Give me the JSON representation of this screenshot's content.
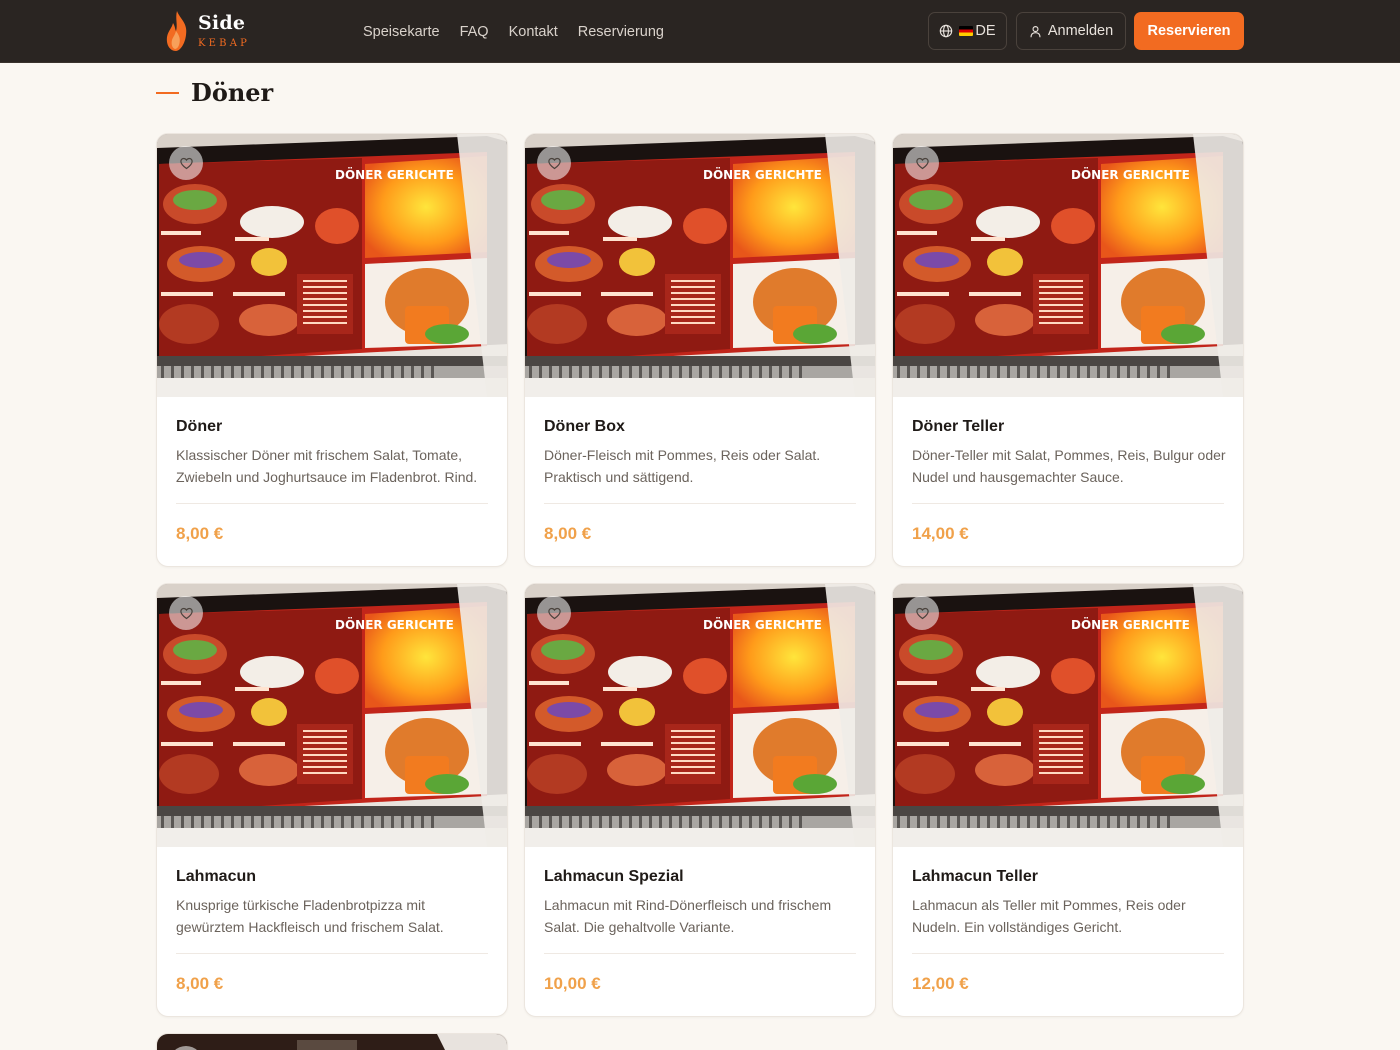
{
  "brand": {
    "name": "Side",
    "tagline": "KEBAP",
    "accent": "#f26b21"
  },
  "nav": [
    {
      "label": "Speisekarte"
    },
    {
      "label": "FAQ"
    },
    {
      "label": "Kontakt"
    },
    {
      "label": "Reservierung"
    }
  ],
  "header": {
    "lang_label": "DE",
    "login_label": "Anmelden",
    "reserve_label": "Reservieren"
  },
  "section": {
    "title": "Döner"
  },
  "image_signage": {
    "heading": "DÖNER GERICHTE"
  },
  "items": [
    {
      "name": "Döner",
      "description": "Klassischer Döner mit frischem Salat, Tomate, Zwiebeln und Joghurtsauce im Fladenbrot. Rind.",
      "price": "8,00 €"
    },
    {
      "name": "Döner Box",
      "description": "Döner-Fleisch mit Pommes, Reis oder Salat. Praktisch und sättigend.",
      "price": "8,00 €"
    },
    {
      "name": "Döner Teller",
      "description": "Döner-Teller mit Salat, Pommes, Reis, Bulgur oder Nudel und hausgemachter Sauce.",
      "price": "14,00 €"
    },
    {
      "name": "Lahmacun",
      "description": "Knusprige türkische Fladenbrotpizza mit gewürztem Hackfleisch und frischem Salat.",
      "price": "8,00 €"
    },
    {
      "name": "Lahmacun Spezial",
      "description": "Lahmacun mit Rind-Dönerfleisch und frischem Salat. Die gehaltvolle Variante.",
      "price": "10,00 €"
    },
    {
      "name": "Lahmacun Teller",
      "description": "Lahmacun als Teller mit Pommes, Reis oder Nudeln. Ein vollständiges Gericht.",
      "price": "12,00 €"
    }
  ],
  "colors": {
    "header_bg": "#2a2522",
    "price": "#f0a14a",
    "page_bg": "#faf7f2"
  }
}
